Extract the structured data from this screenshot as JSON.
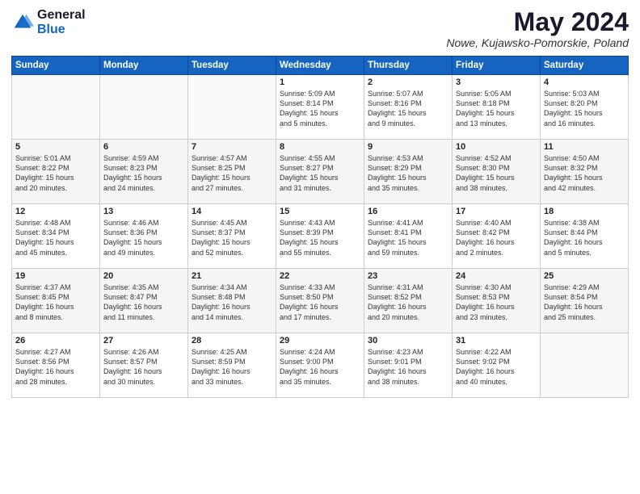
{
  "header": {
    "logo_general": "General",
    "logo_blue": "Blue",
    "month": "May 2024",
    "location": "Nowe, Kujawsko-Pomorskie, Poland"
  },
  "days_of_week": [
    "Sunday",
    "Monday",
    "Tuesday",
    "Wednesday",
    "Thursday",
    "Friday",
    "Saturday"
  ],
  "weeks": [
    [
      {
        "day": "",
        "info": ""
      },
      {
        "day": "",
        "info": ""
      },
      {
        "day": "",
        "info": ""
      },
      {
        "day": "1",
        "info": "Sunrise: 5:09 AM\nSunset: 8:14 PM\nDaylight: 15 hours\nand 5 minutes."
      },
      {
        "day": "2",
        "info": "Sunrise: 5:07 AM\nSunset: 8:16 PM\nDaylight: 15 hours\nand 9 minutes."
      },
      {
        "day": "3",
        "info": "Sunrise: 5:05 AM\nSunset: 8:18 PM\nDaylight: 15 hours\nand 13 minutes."
      },
      {
        "day": "4",
        "info": "Sunrise: 5:03 AM\nSunset: 8:20 PM\nDaylight: 15 hours\nand 16 minutes."
      }
    ],
    [
      {
        "day": "5",
        "info": "Sunrise: 5:01 AM\nSunset: 8:22 PM\nDaylight: 15 hours\nand 20 minutes."
      },
      {
        "day": "6",
        "info": "Sunrise: 4:59 AM\nSunset: 8:23 PM\nDaylight: 15 hours\nand 24 minutes."
      },
      {
        "day": "7",
        "info": "Sunrise: 4:57 AM\nSunset: 8:25 PM\nDaylight: 15 hours\nand 27 minutes."
      },
      {
        "day": "8",
        "info": "Sunrise: 4:55 AM\nSunset: 8:27 PM\nDaylight: 15 hours\nand 31 minutes."
      },
      {
        "day": "9",
        "info": "Sunrise: 4:53 AM\nSunset: 8:29 PM\nDaylight: 15 hours\nand 35 minutes."
      },
      {
        "day": "10",
        "info": "Sunrise: 4:52 AM\nSunset: 8:30 PM\nDaylight: 15 hours\nand 38 minutes."
      },
      {
        "day": "11",
        "info": "Sunrise: 4:50 AM\nSunset: 8:32 PM\nDaylight: 15 hours\nand 42 minutes."
      }
    ],
    [
      {
        "day": "12",
        "info": "Sunrise: 4:48 AM\nSunset: 8:34 PM\nDaylight: 15 hours\nand 45 minutes."
      },
      {
        "day": "13",
        "info": "Sunrise: 4:46 AM\nSunset: 8:36 PM\nDaylight: 15 hours\nand 49 minutes."
      },
      {
        "day": "14",
        "info": "Sunrise: 4:45 AM\nSunset: 8:37 PM\nDaylight: 15 hours\nand 52 minutes."
      },
      {
        "day": "15",
        "info": "Sunrise: 4:43 AM\nSunset: 8:39 PM\nDaylight: 15 hours\nand 55 minutes."
      },
      {
        "day": "16",
        "info": "Sunrise: 4:41 AM\nSunset: 8:41 PM\nDaylight: 15 hours\nand 59 minutes."
      },
      {
        "day": "17",
        "info": "Sunrise: 4:40 AM\nSunset: 8:42 PM\nDaylight: 16 hours\nand 2 minutes."
      },
      {
        "day": "18",
        "info": "Sunrise: 4:38 AM\nSunset: 8:44 PM\nDaylight: 16 hours\nand 5 minutes."
      }
    ],
    [
      {
        "day": "19",
        "info": "Sunrise: 4:37 AM\nSunset: 8:45 PM\nDaylight: 16 hours\nand 8 minutes."
      },
      {
        "day": "20",
        "info": "Sunrise: 4:35 AM\nSunset: 8:47 PM\nDaylight: 16 hours\nand 11 minutes."
      },
      {
        "day": "21",
        "info": "Sunrise: 4:34 AM\nSunset: 8:48 PM\nDaylight: 16 hours\nand 14 minutes."
      },
      {
        "day": "22",
        "info": "Sunrise: 4:33 AM\nSunset: 8:50 PM\nDaylight: 16 hours\nand 17 minutes."
      },
      {
        "day": "23",
        "info": "Sunrise: 4:31 AM\nSunset: 8:52 PM\nDaylight: 16 hours\nand 20 minutes."
      },
      {
        "day": "24",
        "info": "Sunrise: 4:30 AM\nSunset: 8:53 PM\nDaylight: 16 hours\nand 23 minutes."
      },
      {
        "day": "25",
        "info": "Sunrise: 4:29 AM\nSunset: 8:54 PM\nDaylight: 16 hours\nand 25 minutes."
      }
    ],
    [
      {
        "day": "26",
        "info": "Sunrise: 4:27 AM\nSunset: 8:56 PM\nDaylight: 16 hours\nand 28 minutes."
      },
      {
        "day": "27",
        "info": "Sunrise: 4:26 AM\nSunset: 8:57 PM\nDaylight: 16 hours\nand 30 minutes."
      },
      {
        "day": "28",
        "info": "Sunrise: 4:25 AM\nSunset: 8:59 PM\nDaylight: 16 hours\nand 33 minutes."
      },
      {
        "day": "29",
        "info": "Sunrise: 4:24 AM\nSunset: 9:00 PM\nDaylight: 16 hours\nand 35 minutes."
      },
      {
        "day": "30",
        "info": "Sunrise: 4:23 AM\nSunset: 9:01 PM\nDaylight: 16 hours\nand 38 minutes."
      },
      {
        "day": "31",
        "info": "Sunrise: 4:22 AM\nSunset: 9:02 PM\nDaylight: 16 hours\nand 40 minutes."
      },
      {
        "day": "",
        "info": ""
      }
    ]
  ]
}
